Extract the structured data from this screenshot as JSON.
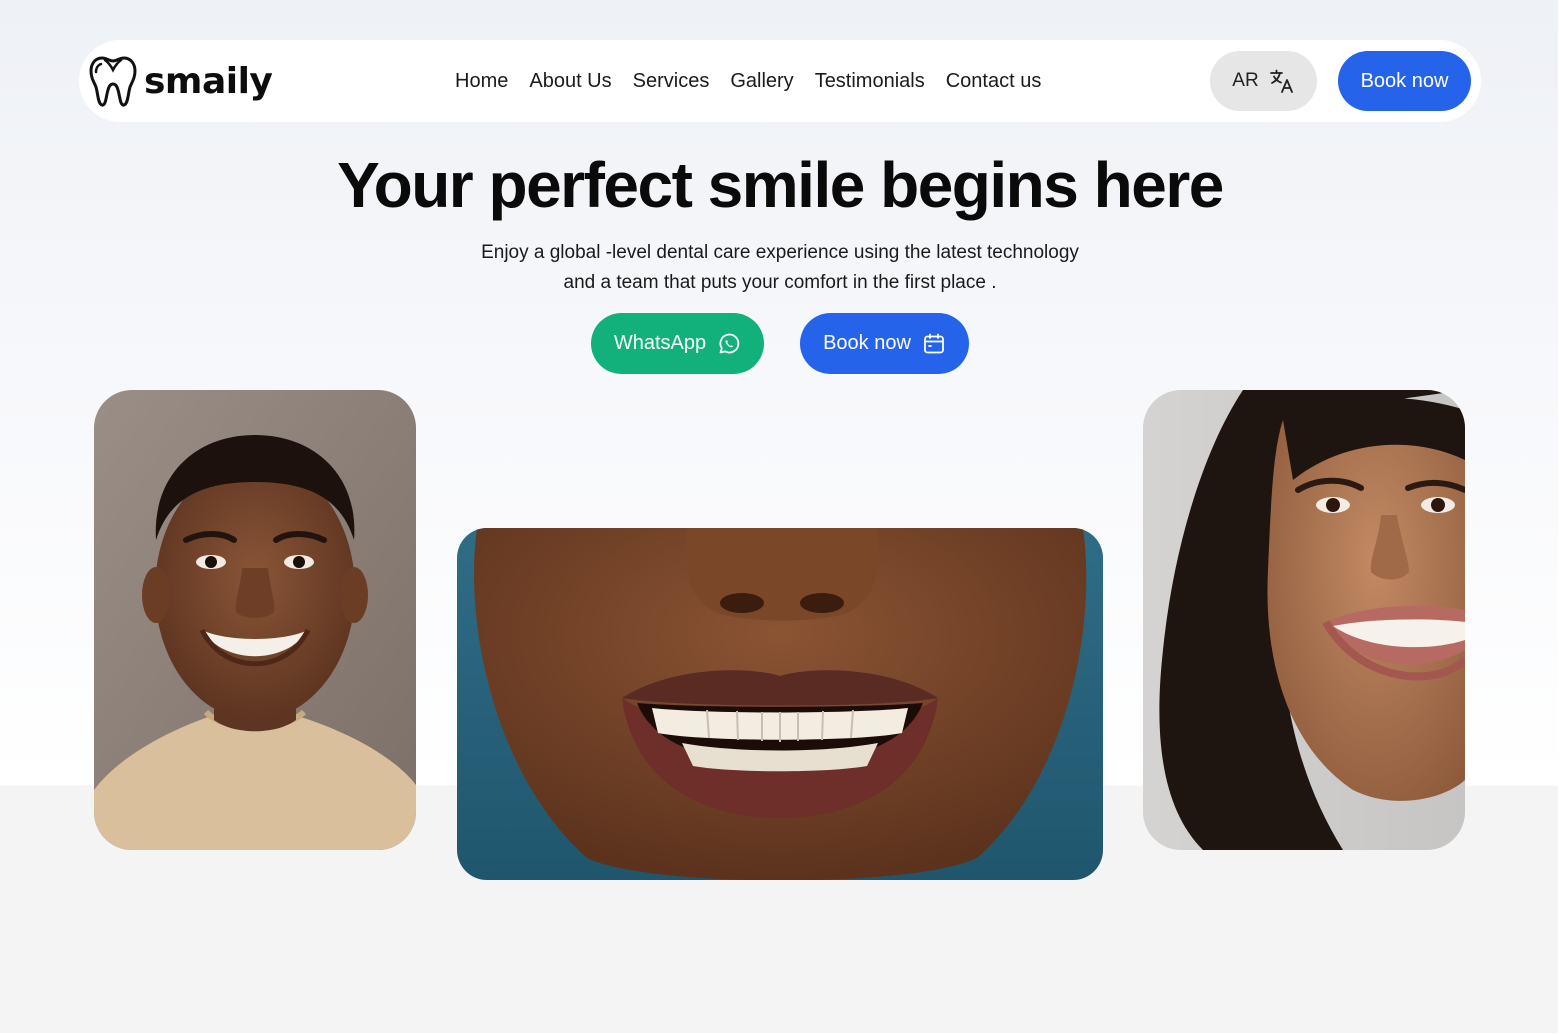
{
  "brand": {
    "name": "smaily",
    "logo_icon": "tooth-icon"
  },
  "nav": {
    "links": [
      "Home",
      "About Us",
      "Services",
      "Gallery",
      "Testimonials",
      "Contact us"
    ],
    "language_label": "AR",
    "language_icon": "translate-icon",
    "book_label": "Book now"
  },
  "hero": {
    "title": "Your perfect smile begins here",
    "subtitle_line1": "Enjoy a global -level dental care experience using the latest technology",
    "subtitle_line2": "and a team that puts your comfort in the first place .",
    "whatsapp_label": "WhatsApp",
    "whatsapp_icon": "whatsapp-icon",
    "book_label": "Book now",
    "book_icon": "calendar-icon"
  },
  "colors": {
    "primary_blue": "#2563eb",
    "whatsapp_green": "#12b07a",
    "language_button_bg": "#e6e6e6"
  }
}
